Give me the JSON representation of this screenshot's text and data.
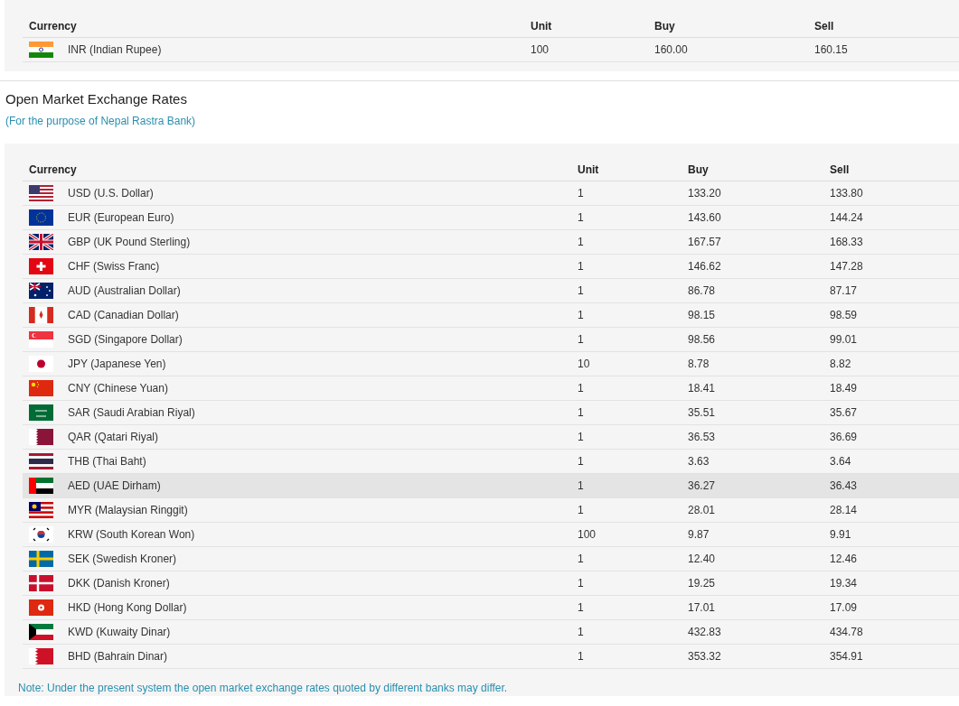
{
  "inr_table": {
    "columns": [
      "Currency",
      "Unit",
      "Buy",
      "Sell"
    ],
    "rows": [
      {
        "kind": "in",
        "currency": "INR (Indian Rupee)",
        "unit": "100",
        "buy": "160.00",
        "sell": "160.15",
        "highlighted": false
      }
    ]
  },
  "title": "Open Market Exchange Rates",
  "subtitle": "(For the purpose of Nepal Rastra Bank)",
  "rates_table": {
    "columns": [
      "Currency",
      "Unit",
      "Buy",
      "Sell"
    ],
    "rows": [
      {
        "kind": "us",
        "currency": "USD (U.S. Dollar)",
        "unit": "1",
        "buy": "133.20",
        "sell": "133.80",
        "highlighted": false
      },
      {
        "kind": "eu",
        "currency": "EUR (European Euro)",
        "unit": "1",
        "buy": "143.60",
        "sell": "144.24",
        "highlighted": false
      },
      {
        "kind": "gb",
        "currency": "GBP (UK Pound Sterling)",
        "unit": "1",
        "buy": "167.57",
        "sell": "168.33",
        "highlighted": false
      },
      {
        "kind": "ch",
        "currency": "CHF (Swiss Franc)",
        "unit": "1",
        "buy": "146.62",
        "sell": "147.28",
        "highlighted": false
      },
      {
        "kind": "au",
        "currency": "AUD (Australian Dollar)",
        "unit": "1",
        "buy": "86.78",
        "sell": "87.17",
        "highlighted": false
      },
      {
        "kind": "ca",
        "currency": "CAD (Canadian Dollar)",
        "unit": "1",
        "buy": "98.15",
        "sell": "98.59",
        "highlighted": false
      },
      {
        "kind": "sg",
        "currency": "SGD (Singapore Dollar)",
        "unit": "1",
        "buy": "98.56",
        "sell": "99.01",
        "highlighted": false
      },
      {
        "kind": "jp",
        "currency": "JPY (Japanese Yen)",
        "unit": "10",
        "buy": "8.78",
        "sell": "8.82",
        "highlighted": false
      },
      {
        "kind": "cn",
        "currency": "CNY (Chinese Yuan)",
        "unit": "1",
        "buy": "18.41",
        "sell": "18.49",
        "highlighted": false
      },
      {
        "kind": "sa",
        "currency": "SAR (Saudi Arabian Riyal)",
        "unit": "1",
        "buy": "35.51",
        "sell": "35.67",
        "highlighted": false
      },
      {
        "kind": "qa",
        "currency": "QAR (Qatari Riyal)",
        "unit": "1",
        "buy": "36.53",
        "sell": "36.69",
        "highlighted": false
      },
      {
        "kind": "th",
        "currency": "THB (Thai Baht)",
        "unit": "1",
        "buy": "3.63",
        "sell": "3.64",
        "highlighted": false
      },
      {
        "kind": "ae",
        "currency": "AED (UAE Dirham)",
        "unit": "1",
        "buy": "36.27",
        "sell": "36.43",
        "highlighted": true
      },
      {
        "kind": "my",
        "currency": "MYR (Malaysian Ringgit)",
        "unit": "1",
        "buy": "28.01",
        "sell": "28.14",
        "highlighted": false
      },
      {
        "kind": "kr",
        "currency": "KRW (South Korean Won)",
        "unit": "100",
        "buy": "9.87",
        "sell": "9.91",
        "highlighted": false
      },
      {
        "kind": "se",
        "currency": "SEK (Swedish Kroner)",
        "unit": "1",
        "buy": "12.40",
        "sell": "12.46",
        "highlighted": false
      },
      {
        "kind": "dk",
        "currency": "DKK (Danish Kroner)",
        "unit": "1",
        "buy": "19.25",
        "sell": "19.34",
        "highlighted": false
      },
      {
        "kind": "hk",
        "currency": "HKD (Hong Kong Dollar)",
        "unit": "1",
        "buy": "17.01",
        "sell": "17.09",
        "highlighted": false
      },
      {
        "kind": "kw",
        "currency": "KWD (Kuwaity Dinar)",
        "unit": "1",
        "buy": "432.83",
        "sell": "434.78",
        "highlighted": false
      },
      {
        "kind": "bh",
        "currency": "BHD (Bahrain Dinar)",
        "unit": "1",
        "buy": "353.32",
        "sell": "354.91",
        "highlighted": false
      }
    ]
  },
  "note": "Note: Under the present system the open market exchange rates quoted by different banks may differ."
}
